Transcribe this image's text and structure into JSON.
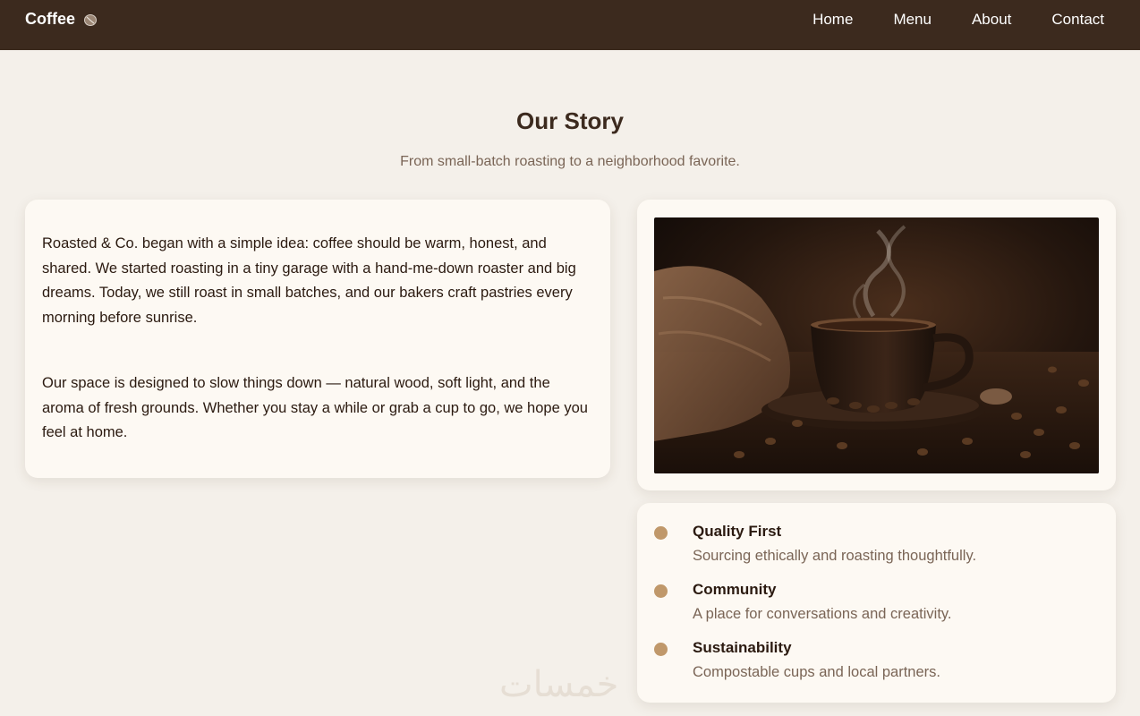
{
  "nav": {
    "brand": "Coffee",
    "brand_icon": "coffee-bean-icon",
    "links": [
      "Home",
      "Menu",
      "About",
      "Contact"
    ]
  },
  "page": {
    "title": "Our Story",
    "subtitle": "From small-batch roasting to a neighborhood favorite."
  },
  "story": {
    "paragraphs": [
      "Roasted & Co. began with a simple idea: coffee should be warm, honest, and shared. We started roasting in a tiny garage with a hand-me-down roaster and big dreams. Today, we still roast in small batches, and our bakers craft pastries every morning before sunrise.",
      "Our space is designed to slow things down — natural wood, soft light, and the aroma of fresh grounds. Whether you stay a while or grab a cup to go, we hope you feel at home."
    ]
  },
  "values": [
    {
      "title": "Quality First",
      "desc": "Sourcing ethically and roasting thoughtfully."
    },
    {
      "title": "Community",
      "desc": "A place for conversations and creativity."
    },
    {
      "title": "Sustainability",
      "desc": "Compostable cups and local partners."
    }
  ],
  "watermark": "خمسات",
  "colors": {
    "nav_bg": "#3c2a1e",
    "page_bg": "#f4f0ea",
    "card_bg": "#fdf9f3",
    "accent": "#c0986a",
    "heading": "#3c2a1e",
    "muted": "#7a6556"
  }
}
